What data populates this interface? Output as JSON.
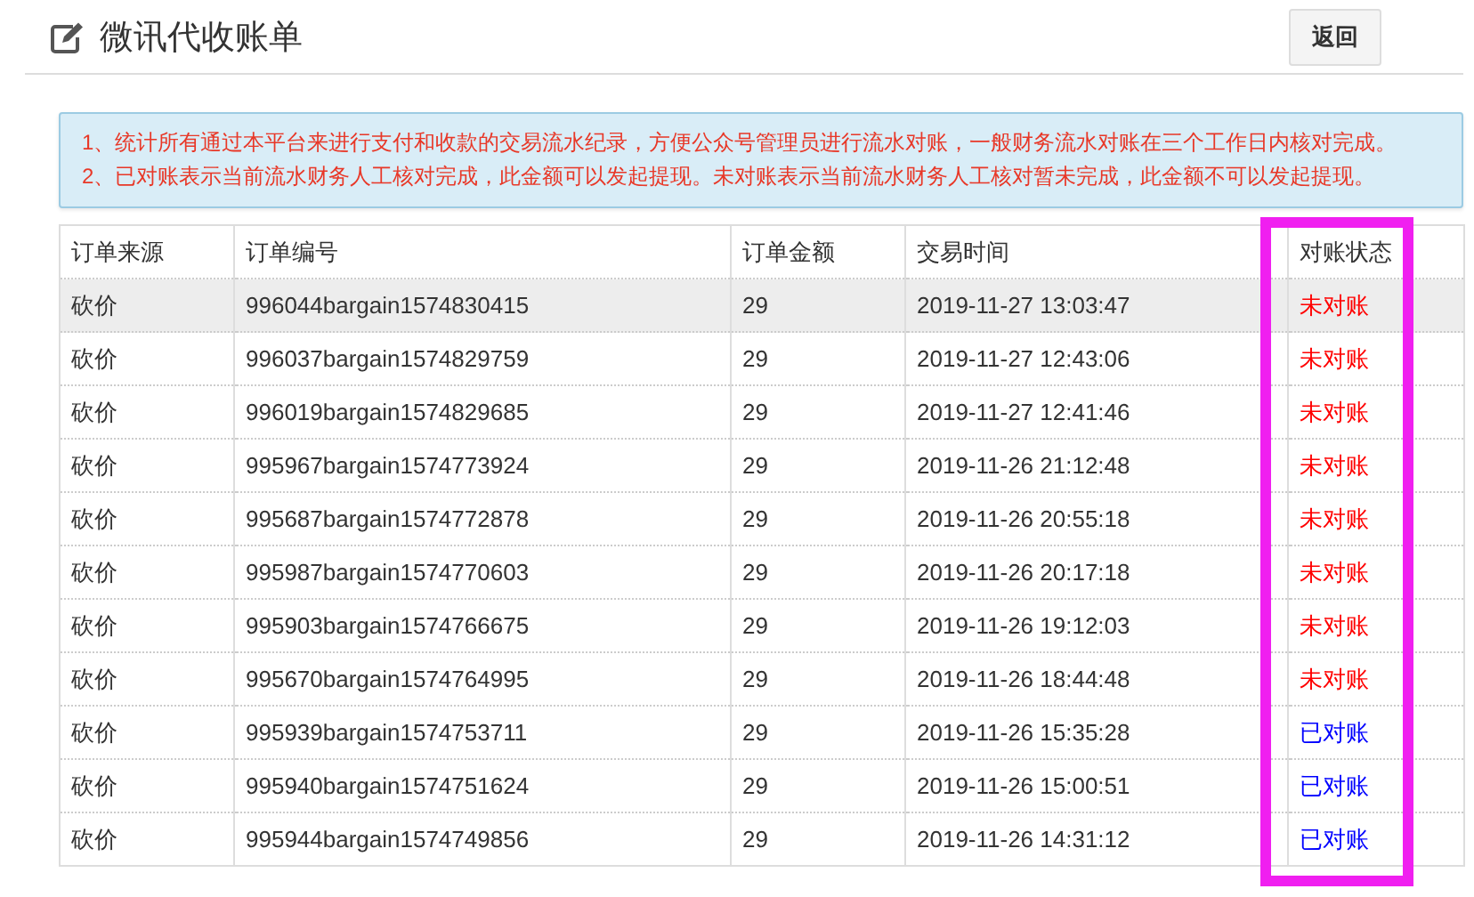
{
  "header": {
    "title": "微讯代收账单",
    "back_button": "返回"
  },
  "notice": [
    "1、统计所有通过本平台来进行支付和收款的交易流水纪录，方便公众号管理员进行流水对账，一般财务流水对账在三个工作日内核对完成。",
    "2、已对账表示当前流水财务人工核对完成，此金额可以发起提现。未对账表示当前流水财务人工核对暂未完成，此金额不可以发起提现。"
  ],
  "table": {
    "columns": [
      "订单来源",
      "订单编号",
      "订单金额",
      "交易时间",
      "对账状态"
    ],
    "rows": [
      {
        "source": "砍价",
        "order_no": "996044bargain1574830415",
        "amount": "29",
        "time": "2019-11-27 13:03:47",
        "status": "未对账",
        "reconciled": false,
        "selected": true
      },
      {
        "source": "砍价",
        "order_no": "996037bargain1574829759",
        "amount": "29",
        "time": "2019-11-27 12:43:06",
        "status": "未对账",
        "reconciled": false,
        "selected": false
      },
      {
        "source": "砍价",
        "order_no": "996019bargain1574829685",
        "amount": "29",
        "time": "2019-11-27 12:41:46",
        "status": "未对账",
        "reconciled": false,
        "selected": false
      },
      {
        "source": "砍价",
        "order_no": "995967bargain1574773924",
        "amount": "29",
        "time": "2019-11-26 21:12:48",
        "status": "未对账",
        "reconciled": false,
        "selected": false
      },
      {
        "source": "砍价",
        "order_no": "995687bargain1574772878",
        "amount": "29",
        "time": "2019-11-26 20:55:18",
        "status": "未对账",
        "reconciled": false,
        "selected": false
      },
      {
        "source": "砍价",
        "order_no": "995987bargain1574770603",
        "amount": "29",
        "time": "2019-11-26 20:17:18",
        "status": "未对账",
        "reconciled": false,
        "selected": false
      },
      {
        "source": "砍价",
        "order_no": "995903bargain1574766675",
        "amount": "29",
        "time": "2019-11-26 19:12:03",
        "status": "未对账",
        "reconciled": false,
        "selected": false
      },
      {
        "source": "砍价",
        "order_no": "995670bargain1574764995",
        "amount": "29",
        "time": "2019-11-26 18:44:48",
        "status": "未对账",
        "reconciled": false,
        "selected": false
      },
      {
        "source": "砍价",
        "order_no": "995939bargain1574753711",
        "amount": "29",
        "time": "2019-11-26 15:35:28",
        "status": "已对账",
        "reconciled": true,
        "selected": false
      },
      {
        "source": "砍价",
        "order_no": "995940bargain1574751624",
        "amount": "29",
        "time": "2019-11-26 15:00:51",
        "status": "已对账",
        "reconciled": true,
        "selected": false
      },
      {
        "source": "砍价",
        "order_no": "995944bargain1574749856",
        "amount": "29",
        "time": "2019-11-26 14:31:12",
        "status": "已对账",
        "reconciled": true,
        "selected": false
      }
    ]
  }
}
